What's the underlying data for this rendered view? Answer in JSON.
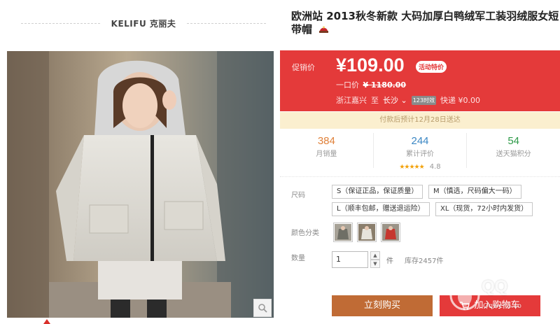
{
  "brand": {
    "name": "KELIFU 克丽夫"
  },
  "product": {
    "title_line1": "欧洲站 2013秋冬新款 大码加厚白鸭绒军工装羽绒服女短",
    "title_line2": "带帽"
  },
  "price": {
    "promo_label": "促销价",
    "current": "¥109.00",
    "badge": "活动特价",
    "original_label": "一口价",
    "original_value": "¥ 1180.00"
  },
  "shipping": {
    "from": "浙江嘉兴",
    "to_word": "至",
    "city": "长沙",
    "time_badge": "123时效",
    "express": "快递 ¥0.00"
  },
  "notice": "付款后预计12月28日送达",
  "stats": [
    {
      "value": "384",
      "label": "月销量",
      "color": "#e0813a"
    },
    {
      "value": "244",
      "label": "累计评价",
      "color": "#3b87c4",
      "stars": "★★★★★",
      "rating": "4.8"
    },
    {
      "value": "54",
      "label": "送天猫积分",
      "color": "#2e9a48"
    }
  ],
  "options": {
    "size_label": "尺码",
    "sizes": [
      "S（保证正品，保证质量）",
      "M（慎选，尺码偏大一码）",
      "L（顺丰包邮，赠送退运险）",
      "XL（现货，72小时内发货）"
    ],
    "color_label": "颜色分类",
    "colors": [
      "grey-coat",
      "white-coat",
      "red-coat"
    ]
  },
  "quantity": {
    "label": "数量",
    "value": "1",
    "unit": "件",
    "stock": "库存2457件"
  },
  "actions": {
    "buy_now": "立刻购买",
    "add_to_cart": "加入购物车"
  },
  "watermark": {
    "text": "QQ",
    "url": "Qqweila.co"
  },
  "colors": {
    "price_red": "#e43a3a",
    "buy_orange": "#c06b35",
    "notice_bg": "#fbefcf"
  }
}
